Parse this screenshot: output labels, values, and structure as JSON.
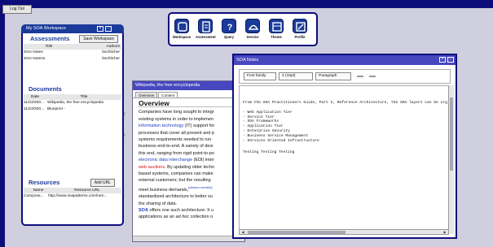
{
  "topbar": {
    "logout_label": "Log Out"
  },
  "workspace": {
    "title": "My SOA Workspace",
    "assessments": {
      "heading": "Assessments",
      "save_label": "Save Workspace",
      "columns": [
        "Title",
        "Authors"
      ],
      "rows": [
        [
          "SOA Notes",
          "bschlicher"
        ],
        [
          "SOA Notes2",
          "bschlicher"
        ]
      ]
    },
    "documents": {
      "heading": "Documents",
      "columns": [
        "Date",
        "Title"
      ],
      "rows": [
        [
          "11/23/200...",
          "Wikipedia, the free encyclopedia"
        ],
        [
          "11/23/200...",
          "Blueprint -"
        ]
      ]
    },
    "resources": {
      "heading": "Resources",
      "add_label": "Add URL",
      "columns": [
        "Name",
        "Resource URL"
      ],
      "rows": [
        [
          "Composa...",
          "http://www.soapatterns.com/ram..."
        ]
      ]
    }
  },
  "toolbar": {
    "tools": [
      {
        "label": "Workspace",
        "icon": "workspace-icon"
      },
      {
        "label": "Assessment",
        "icon": "assessment-icon"
      },
      {
        "label": "Query",
        "icon": "query-icon"
      },
      {
        "label": "Service",
        "icon": "service-icon"
      },
      {
        "label": "Theme",
        "icon": "theme-icon"
      },
      {
        "label": "Profile",
        "icon": "profile-icon"
      }
    ]
  },
  "wiki": {
    "title": "Wikipedia, the free encyclopedia",
    "tabs": [
      "Overview",
      "Content"
    ],
    "heading": "Overview",
    "lines": [
      "Companies have long sought to integr",
      "existing systems in order to implemen",
      "information technology",
      "(IT) support for",
      "processes that cover all present and p",
      "systems requirements needed to run",
      "business end-to-end. A variety of desi",
      "this end, ranging from rigid point-to-po",
      "electronic data interchange",
      "(EDI) inter",
      "web auctions",
      ". By updating older techn",
      "based systems, companies can make",
      "external customers; but the resulting",
      "meet business demands,",
      "[citation needed]",
      "standardized architecture to better su",
      "the sharing of data.",
      "SOA",
      "offers one such architecture. It u",
      "applications as an",
      "ad hoc",
      "collection o"
    ]
  },
  "notes": {
    "title": "SOA Notes",
    "font_family": "Font family",
    "font_size": "2 (10pt)",
    "block": "Paragraph",
    "intro": "From the SOA Practitioners Guide, Part 2, Reference Architecture, the SOA layers can be org",
    "bullets": [
      "- Web Application Tier",
      "- Service Tier",
      "- SOA Frameworks",
      "- Application Tier",
      "- Enterprise Security",
      "- Business Service Management",
      "- Services Oriented Infrastructure"
    ],
    "footer": "Testing Testing Testing"
  }
}
